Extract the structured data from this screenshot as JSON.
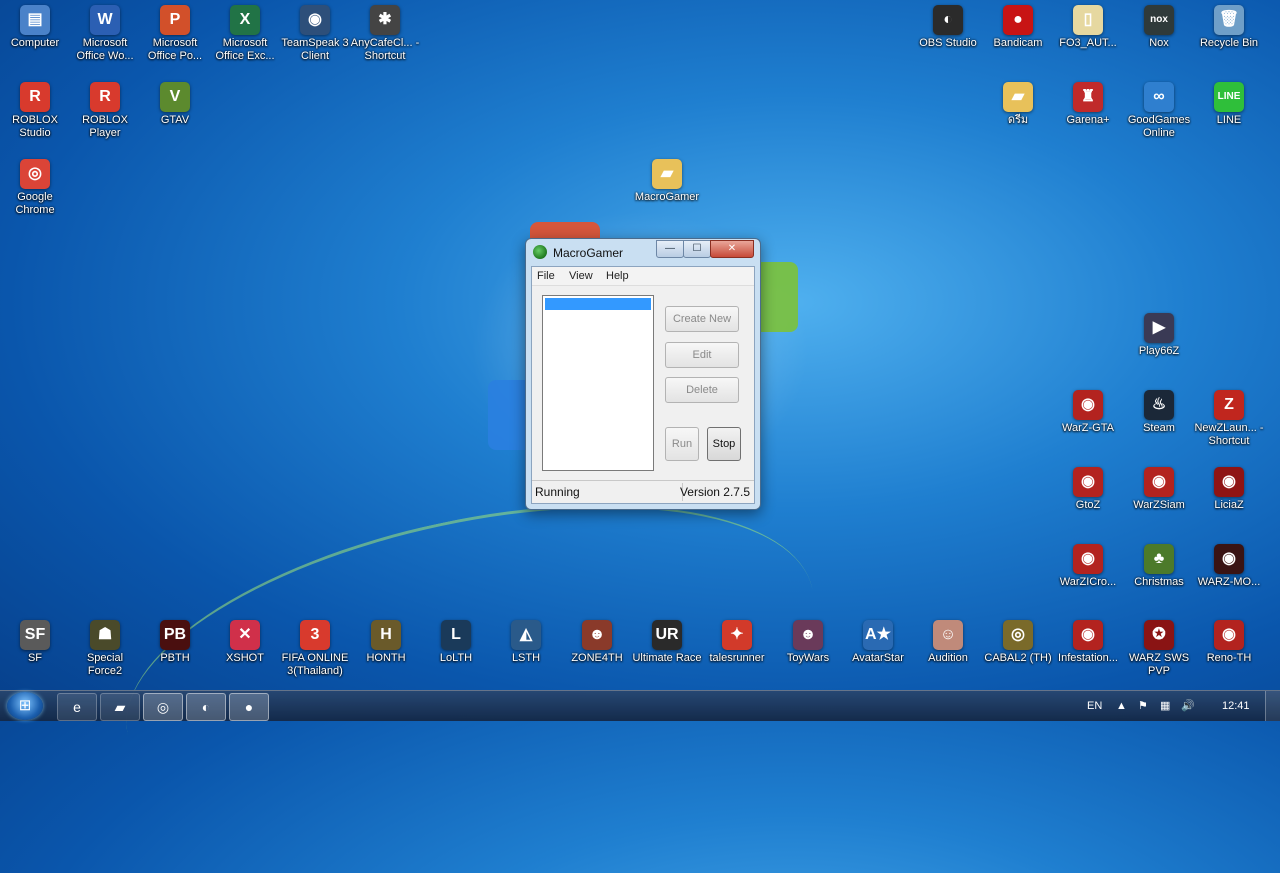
{
  "desktop": {
    "icons": [
      {
        "label": "Computer",
        "glyph": "▤",
        "color": "#4a82c9"
      },
      {
        "label": "Microsoft Office Wo...",
        "glyph": "W",
        "color": "#2b5fb3"
      },
      {
        "label": "Microsoft Office Po...",
        "glyph": "P",
        "color": "#d2502a"
      },
      {
        "label": "Microsoft Office Exc...",
        "glyph": "X",
        "color": "#217346"
      },
      {
        "label": "TeamSpeak 3 Client",
        "glyph": "◉",
        "color": "#2d4f7a"
      },
      {
        "label": "AnyCafeCl... - Shortcut",
        "glyph": "✱",
        "color": "#444444"
      },
      {
        "label": "ROBLOX Studio",
        "glyph": "R",
        "color": "#d83a2d"
      },
      {
        "label": "ROBLOX Player",
        "glyph": "R",
        "color": "#d83a2d"
      },
      {
        "label": "GTAV",
        "glyph": "V",
        "color": "#5c8a2e"
      },
      {
        "label": "Google Chrome",
        "glyph": "◎",
        "color": "#db4437"
      },
      {
        "label": "MacroGamer",
        "glyph": "▰",
        "color": "#e8c15a"
      },
      {
        "label": "OBS Studio",
        "glyph": "◐",
        "color": "#2b2b2b"
      },
      {
        "label": "Bandicam",
        "glyph": "●",
        "color": "#c81414"
      },
      {
        "label": "FO3_AUT...",
        "glyph": "▯",
        "color": "#e6d8a0"
      },
      {
        "label": "Nox",
        "glyph": "nox",
        "color": "#2f3a3a"
      },
      {
        "label": "Recycle Bin",
        "glyph": "🗑",
        "color": "#6f9fc8"
      },
      {
        "label": "ดรีม",
        "glyph": "▰",
        "color": "#e8c15a"
      },
      {
        "label": "Garena+",
        "glyph": "♜",
        "color": "#c02a2a"
      },
      {
        "label": "GoodGames Online",
        "glyph": "∞",
        "color": "#2f7fcf"
      },
      {
        "label": "LINE",
        "glyph": "LINE",
        "color": "#2fbf3a"
      },
      {
        "label": "Play66Z",
        "glyph": "▶",
        "color": "#3a3a55"
      },
      {
        "label": "WarZ-GTA",
        "glyph": "◉",
        "color": "#b3231f"
      },
      {
        "label": "Steam",
        "glyph": "♨",
        "color": "#1b2838"
      },
      {
        "label": "NewZLaun... - Shortcut",
        "glyph": "Z",
        "color": "#c0261e"
      },
      {
        "label": "GtoZ",
        "glyph": "◉",
        "color": "#b3231f"
      },
      {
        "label": "WarZSiam",
        "glyph": "◉",
        "color": "#b3231f"
      },
      {
        "label": "LiciaZ",
        "glyph": "◉",
        "color": "#8f1414"
      },
      {
        "label": "WarZICro...",
        "glyph": "◉",
        "color": "#b3231f"
      },
      {
        "label": "Christmas",
        "glyph": "♣",
        "color": "#4c7a2a"
      },
      {
        "label": "WARZ-MO...",
        "glyph": "◉",
        "color": "#3a1414"
      },
      {
        "label": "SF",
        "glyph": "SF",
        "color": "#5a5a5a"
      },
      {
        "label": "Special Force2",
        "glyph": "☗",
        "color": "#4a4a2a"
      },
      {
        "label": "PBTH",
        "glyph": "PB",
        "color": "#4a0f0f"
      },
      {
        "label": "XSHOT",
        "glyph": "✕",
        "color": "#d0304a"
      },
      {
        "label": "FIFA ONLINE 3(Thailand)",
        "glyph": "3",
        "color": "#d83a2d"
      },
      {
        "label": "HONTH",
        "glyph": "H",
        "color": "#6a5a2a"
      },
      {
        "label": "LoLTH",
        "glyph": "L",
        "color": "#1a3a5a"
      },
      {
        "label": "LSTH",
        "glyph": "◭",
        "color": "#2a5a8a"
      },
      {
        "label": "ZONE4TH",
        "glyph": "☻",
        "color": "#8a3a2a"
      },
      {
        "label": "Ultimate Race",
        "glyph": "UR",
        "color": "#2a2a2a"
      },
      {
        "label": "talesrunner",
        "glyph": "✦",
        "color": "#d23a2a"
      },
      {
        "label": "ToyWars",
        "glyph": "☻",
        "color": "#6a3a5a"
      },
      {
        "label": "AvatarStar",
        "glyph": "A★",
        "color": "#2a6ab3"
      },
      {
        "label": "Audition",
        "glyph": "☺",
        "color": "#c08a7a"
      },
      {
        "label": "CABAL2 (TH)",
        "glyph": "◎",
        "color": "#7a6a2a"
      },
      {
        "label": "Infestation...",
        "glyph": "◉",
        "color": "#b3231f"
      },
      {
        "label": "WARZ SWS PVP",
        "glyph": "✪",
        "color": "#8a1414"
      },
      {
        "label": "Reno-TH",
        "glyph": "◉",
        "color": "#b3231f"
      }
    ]
  },
  "window": {
    "title": "MacroGamer",
    "menu": [
      "File",
      "View",
      "Help"
    ],
    "buttons": {
      "create_new": "Create New",
      "edit": "Edit",
      "delete": "Delete",
      "run": "Run",
      "stop": "Stop"
    },
    "status": "Running",
    "version": "Version 2.7.5",
    "controls": {
      "minimize": "—",
      "maximize": "☐",
      "close": "✕"
    }
  },
  "taskbar": {
    "start_glyph": "⊞",
    "buttons": [
      {
        "name": "ie-icon",
        "glyph": "e"
      },
      {
        "name": "explorer-icon",
        "glyph": "▰"
      },
      {
        "name": "chrome-icon",
        "glyph": "◎"
      },
      {
        "name": "obs-icon",
        "glyph": "◐"
      },
      {
        "name": "macrogamer-icon",
        "glyph": "●"
      }
    ],
    "language": "EN",
    "time": "12:41"
  }
}
